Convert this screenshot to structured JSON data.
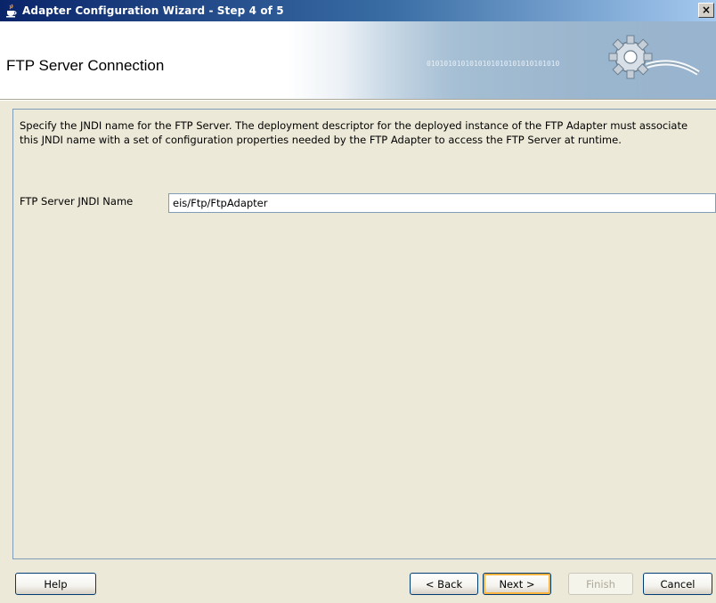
{
  "window": {
    "title": "Adapter Configuration Wizard - Step 4 of 5",
    "close_label": "×"
  },
  "banner": {
    "heading": "FTP Server Connection",
    "binary_art": "0101010101010101010101010101010"
  },
  "content": {
    "description": "Specify the JNDI name for the FTP Server.  The deployment descriptor for the deployed instance of the FTP Adapter must associate this JNDI name with a set of configuration properties needed by the FTP Adapter to access the FTP Server at runtime.",
    "jndi_label": "FTP Server JNDI Name",
    "jndi_value": "eis/Ftp/FtpAdapter"
  },
  "buttons": {
    "help": "Help",
    "back": "< Back",
    "next": "Next >",
    "finish": "Finish",
    "cancel": "Cancel"
  },
  "colors": {
    "title_bar": "#0a246a",
    "dialog_bg": "#ece9d8",
    "default_button_focus": "#f9b33e"
  }
}
